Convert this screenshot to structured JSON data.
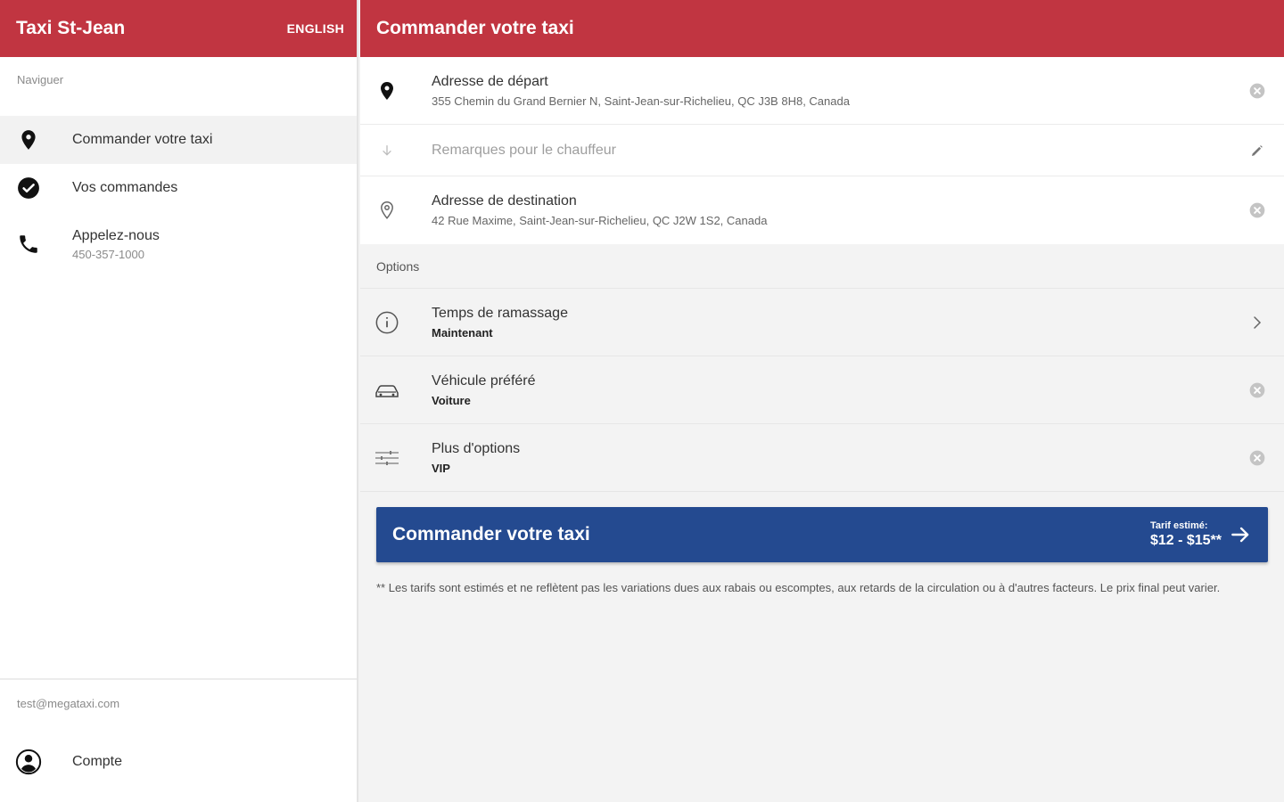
{
  "sidebar": {
    "app_title": "Taxi St-Jean",
    "language_label": "ENGLISH",
    "nav_caption": "Naviguer",
    "items": [
      {
        "label": "Commander votre taxi",
        "icon": "location-pin-icon",
        "active": true
      },
      {
        "label": "Vos commandes",
        "icon": "check-circle-icon"
      },
      {
        "label": "Appelez-nous",
        "sublabel": "450-357-1000",
        "icon": "phone-icon"
      }
    ],
    "user_email": "test@megataxi.com",
    "account_label": "Compte"
  },
  "header": {
    "title": "Commander votre taxi"
  },
  "addresses": {
    "pickup": {
      "title": "Adresse de départ",
      "value": "355 Chemin du Grand Bernier N, Saint-Jean-sur-Richelieu, QC J3B 8H8, Canada"
    },
    "notes": {
      "placeholder": "Remarques pour le chauffeur"
    },
    "destination": {
      "title": "Adresse de destination",
      "value": "42 Rue Maxime, Saint-Jean-sur-Richelieu, QC J2W 1S2, Canada"
    }
  },
  "options": {
    "caption": "Options",
    "pickup_time": {
      "title": "Temps de ramassage",
      "value": "Maintenant"
    },
    "vehicle": {
      "title": "Véhicule préféré",
      "value": "Voiture"
    },
    "more": {
      "title": "Plus d'options",
      "value": "VIP"
    }
  },
  "order": {
    "label": "Commander votre taxi",
    "fare_caption": "Tarif estimé:",
    "fare_range": "$12 - $15**"
  },
  "disclaimer": "** Les tarifs sont estimés et ne reflètent pas les variations dues aux rabais ou escomptes, aux retards de la circulation ou à d'autres facteurs. Le prix final peut varier.",
  "colors": {
    "brand_red": "#c13541",
    "action_blue": "#244a90"
  }
}
